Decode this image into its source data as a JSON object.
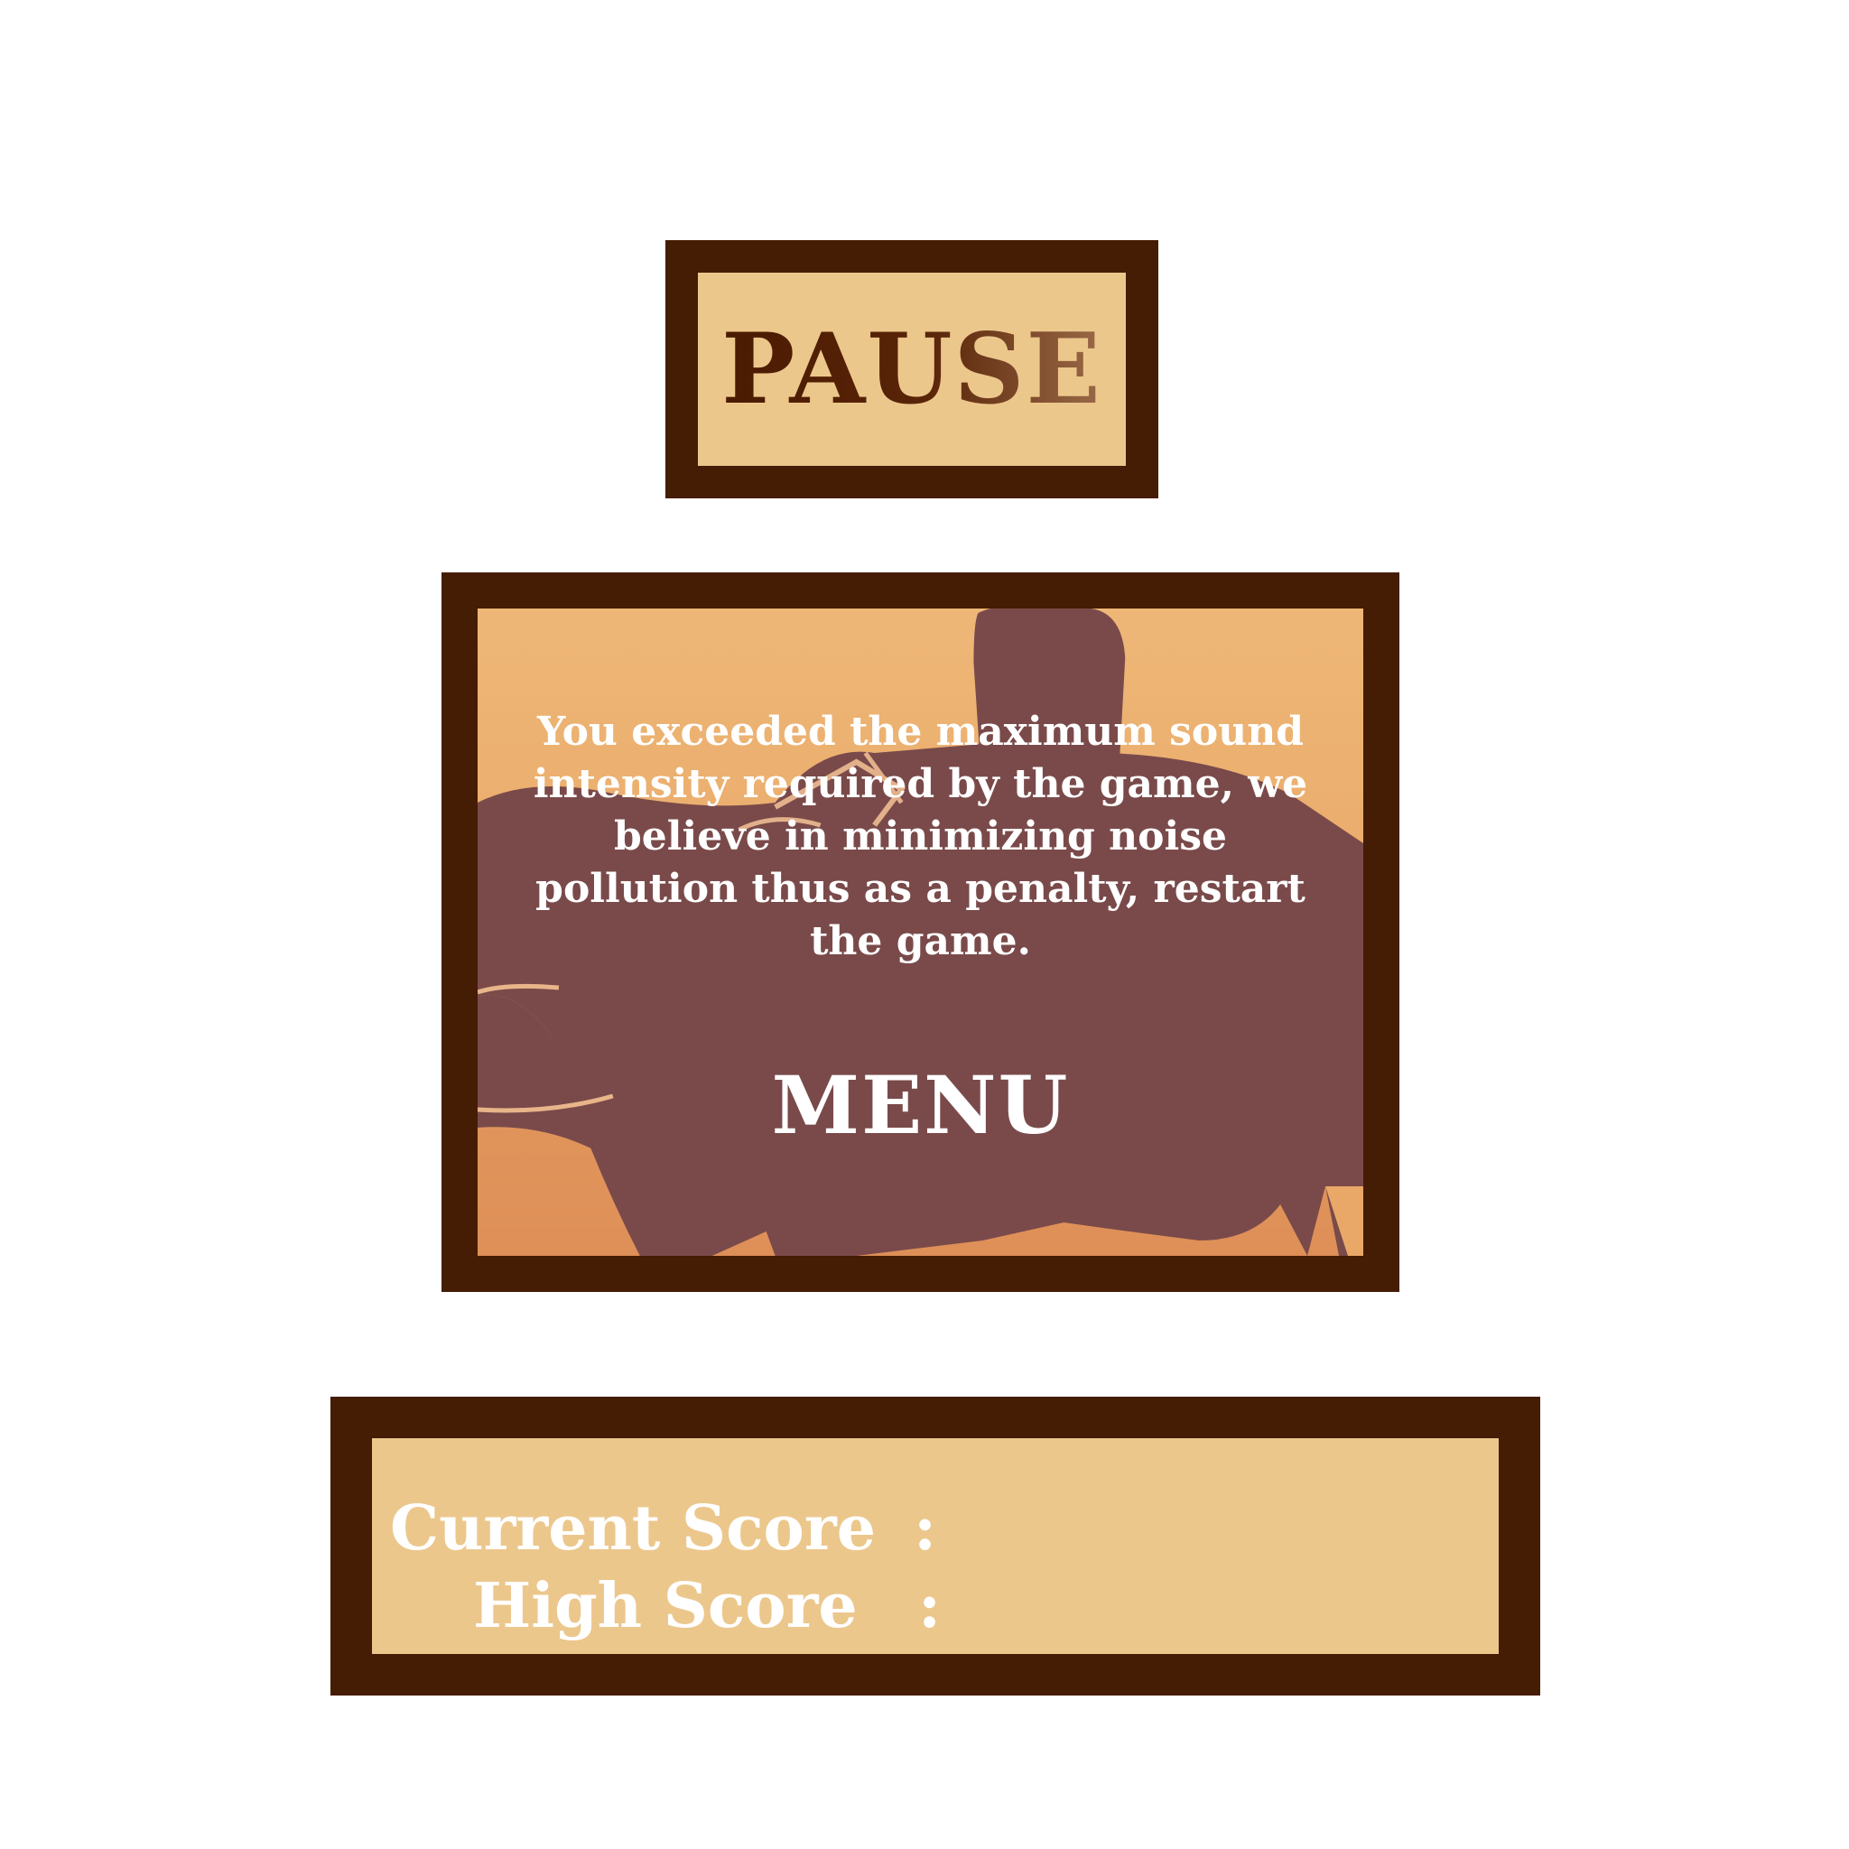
{
  "pause": {
    "title": "PAUSE"
  },
  "message": {
    "lines": [
      "You exceeded the maximum sound",
      "intensity required by the game, we",
      "believe in minimizing noise",
      "pollution thus as a penalty, restart",
      "the game."
    ],
    "menu_label": "MENU"
  },
  "scores": {
    "current_label": "Current Score",
    "high_label": "High Score",
    "separator": ":"
  },
  "colors": {
    "frame": "#451c04",
    "panel_fill": "#ecc78c",
    "silhouette": "#7a4a4a",
    "text": "#ffffff"
  }
}
